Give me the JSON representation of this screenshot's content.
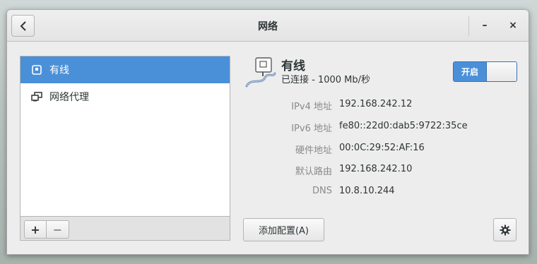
{
  "window": {
    "title": "网络",
    "minimize_label": "–",
    "close_label": "×"
  },
  "sidebar": {
    "items": [
      {
        "label": "有线",
        "icon": "wired-network-icon",
        "selected": true
      },
      {
        "label": "网络代理",
        "icon": "network-proxy-icon",
        "selected": false
      }
    ],
    "add_label": "+",
    "remove_label": "−"
  },
  "device": {
    "name": "有线",
    "status": "已连接 - 1000 Mb/秒",
    "switch_label": "开启",
    "switch_on": true
  },
  "details": [
    {
      "label": "IPv4 地址",
      "value": "192.168.242.12"
    },
    {
      "label": "IPv6 地址",
      "value": "fe80::22d0:dab5:9722:35ce"
    },
    {
      "label": "硬件地址",
      "value": "00:0C:29:52:AF:16"
    },
    {
      "label": "默认路由",
      "value": "192.168.242.10"
    },
    {
      "label": "DNS",
      "value": "10.8.10.244"
    }
  ],
  "buttons": {
    "add_profile": "添加配置(A)"
  },
  "colors": {
    "accent": "#4a90d9"
  }
}
